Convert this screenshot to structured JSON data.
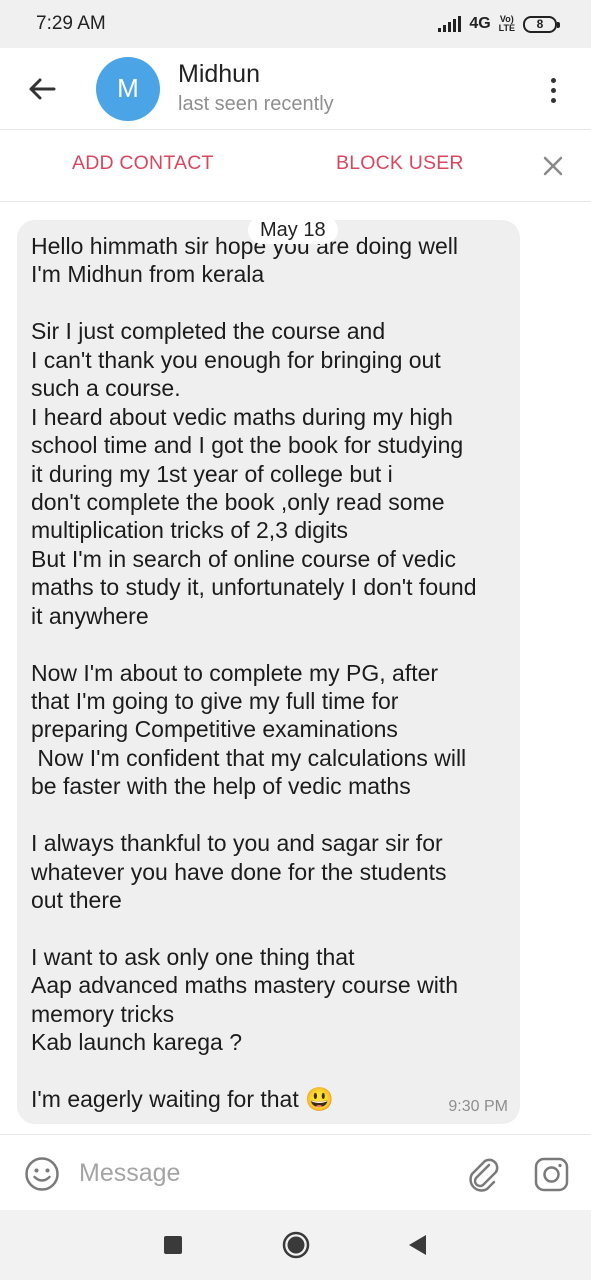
{
  "status_bar": {
    "time": "7:29 AM",
    "network": "4G",
    "volte_top": "Vo)",
    "volte_bottom": "LTE",
    "battery": "8"
  },
  "header": {
    "avatar_letter": "M",
    "name": "Midhun",
    "status": "last seen recently"
  },
  "action_bar": {
    "add_contact": "ADD CONTACT",
    "block_user": "BLOCK USER"
  },
  "chat": {
    "date": "May 18",
    "message": {
      "lines": [
        "Hello himmath sir hope you are doing well",
        "I'm Midhun from kerala",
        "",
        "Sir I just completed the course and",
        "I can't thank you enough for bringing out",
        "such a course.",
        "I heard about vedic maths during my high",
        "school time and I got the book for studying",
        "it during my 1st year of college but i",
        "don't complete the book ,only read some",
        "multiplication tricks of 2,3 digits",
        "But I'm in search of online course of vedic",
        "maths to study it, unfortunately I don't found",
        "it anywhere",
        "",
        "Now I'm about to complete my PG, after",
        "that I'm going to give my full time for",
        "preparing Competitive examinations",
        " Now I'm confident that my calculations will",
        "be faster with the help of vedic maths",
        "",
        "I always thankful to you and sagar sir for",
        "whatever you have done for the students",
        "out there",
        "",
        "I want to ask only one thing that",
        "Aap advanced maths mastery course with",
        "memory tricks",
        "Kab launch karega ?",
        "",
        "I'm eagerly waiting for that 😃"
      ],
      "time": "9:30 PM"
    }
  },
  "input_bar": {
    "placeholder": "Message"
  },
  "icons": {
    "back": "arrow-back-icon",
    "menu": "more-vert-icon",
    "close": "close-icon",
    "emoji": "emoji-icon",
    "attach": "paperclip-icon",
    "camera": "camera-icon"
  },
  "colors": {
    "accent_red": "#d9475f",
    "avatar_blue": "#4aa4e6",
    "bubble_bg": "#efefef"
  }
}
